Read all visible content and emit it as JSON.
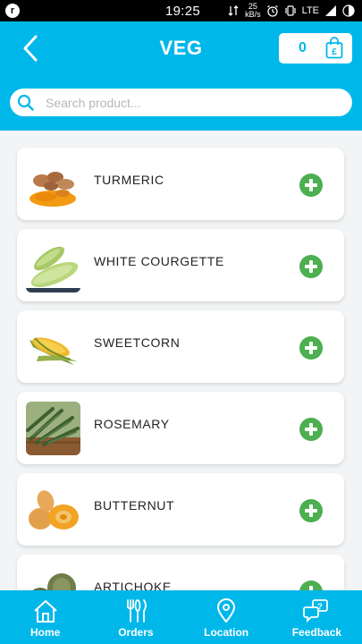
{
  "status_bar": {
    "app_icon_letter": "r",
    "time": "19:25",
    "speed_value": "25",
    "speed_unit": "kB/s",
    "network": "LTE"
  },
  "header": {
    "title": "VEG",
    "cart_count": "0",
    "search_placeholder": "Search product..."
  },
  "products": [
    {
      "name": "TURMERIC",
      "image": "turmeric"
    },
    {
      "name": "WHITE COURGETTE",
      "image": "courgette"
    },
    {
      "name": "SWEETCORN",
      "image": "sweetcorn"
    },
    {
      "name": "ROSEMARY",
      "image": "rosemary"
    },
    {
      "name": "BUTTERNUT",
      "image": "butternut"
    },
    {
      "name": "ARTICHOKE",
      "image": "artichoke"
    }
  ],
  "bottom_nav": [
    {
      "label": "Home",
      "icon": "home-icon"
    },
    {
      "label": "Orders",
      "icon": "cutlery-icon"
    },
    {
      "label": "Location",
      "icon": "location-pin-icon"
    },
    {
      "label": "Feedback",
      "icon": "feedback-icon"
    }
  ],
  "colors": {
    "primary": "#00b7ea",
    "add_button": "#4caf50",
    "background": "#f2f4f6"
  }
}
